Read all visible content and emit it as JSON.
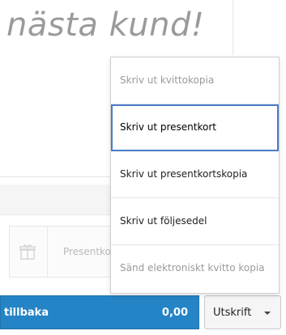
{
  "background": {
    "title": "nästa kund!",
    "gift_card_label": "Presentkort"
  },
  "back_button": {
    "label": "tillbaka",
    "amount": "0,00"
  },
  "print_button": {
    "label": "Utskrift"
  },
  "print_menu": {
    "items": [
      {
        "label": "Skriv ut kvittokopia",
        "state": "disabled"
      },
      {
        "label": "Skriv ut presentkort",
        "state": "selected"
      },
      {
        "label": "Skriv ut presentkortskopia",
        "state": "enabled"
      },
      {
        "label": "Skriv ut följesedel",
        "state": "enabled"
      },
      {
        "label": "Sänd elektroniskt kvitto kopia",
        "state": "disabled"
      }
    ]
  },
  "colors": {
    "primary_button": "#2484c6",
    "selection_border": "#4a7bc8"
  }
}
